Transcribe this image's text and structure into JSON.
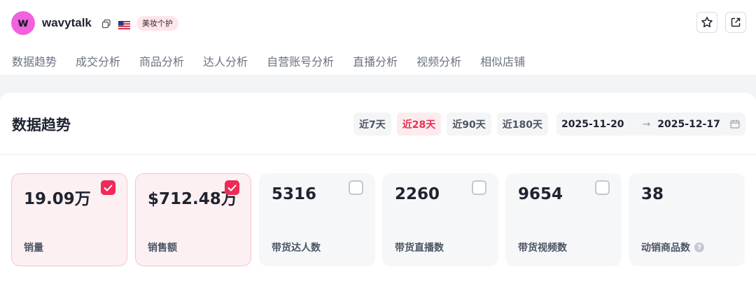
{
  "header": {
    "logo_letter": "w",
    "shop_name": "wavytalk",
    "category_badge": "美妆个护",
    "flag_icon": "us-flag-icon",
    "copy_icon": "copy-icon",
    "actions": [
      "star-icon",
      "external-link-icon"
    ]
  },
  "nav": {
    "items": [
      "数据趋势",
      "成交分析",
      "商品分析",
      "达人分析",
      "自营账号分析",
      "直播分析",
      "视频分析",
      "相似店铺"
    ]
  },
  "panel": {
    "title": "数据趋势",
    "ranges": [
      "近7天",
      "近28天",
      "近90天",
      "近180天"
    ],
    "active_range": "近28天",
    "date_start": "2025-11-20",
    "date_arrow": "→",
    "date_end": "2025-12-17"
  },
  "metrics": [
    {
      "value": "19.09万",
      "label": "销量",
      "checked": true
    },
    {
      "value": "$712.48万",
      "label": "销售额",
      "checked": true
    },
    {
      "value": "5316",
      "label": "带货达人数",
      "checked": false
    },
    {
      "value": "2260",
      "label": "带货直播数",
      "checked": false
    },
    {
      "value": "9654",
      "label": "带货视频数",
      "checked": false
    },
    {
      "value": "38",
      "label": "动销商品数",
      "help": true
    }
  ],
  "colors": {
    "accent": "#e8304f",
    "checkbox_checked": "#ee2b58",
    "logo_bg": "#f062e0",
    "selected_card_bg": "#fdf0f2"
  }
}
